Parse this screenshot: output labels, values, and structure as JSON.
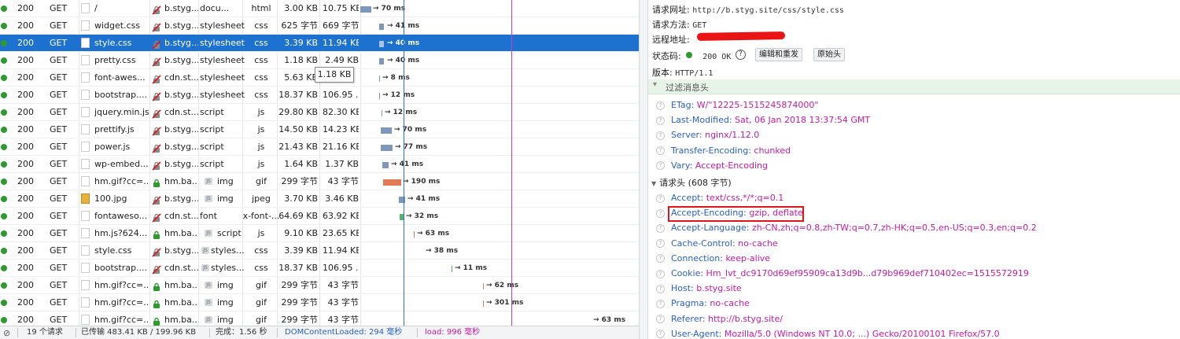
{
  "columns": [
    "status",
    "method",
    "file",
    "domain",
    "cause",
    "type",
    "transferred",
    "size",
    "waterfall"
  ],
  "requests": [
    {
      "status": "200",
      "method": "GET",
      "file": "/",
      "domain": "b.styg...",
      "cause": "docu...",
      "type": "html",
      "transferred": "3.00 KB",
      "size": "10.75 KB",
      "timing": "→ 70 ms",
      "icon": "doc",
      "lock": "broken",
      "selected": false
    },
    {
      "status": "200",
      "method": "GET",
      "file": "widget.css",
      "domain": "b.styg...",
      "cause": "stylesheet",
      "type": "css",
      "transferred": "625 字节",
      "size": "669 字节",
      "timing": "→ 41 ms",
      "icon": "doc",
      "lock": "broken",
      "selected": false
    },
    {
      "status": "200",
      "method": "GET",
      "file": "style.css",
      "domain": "b.styg...",
      "cause": "stylesheet",
      "type": "css",
      "transferred": "3.39 KB",
      "size": "11.94 KB",
      "timing": "→ 40 ms",
      "icon": "doc",
      "lock": "broken",
      "selected": true
    },
    {
      "status": "200",
      "method": "GET",
      "file": "pretty.css",
      "domain": "b.styg...",
      "cause": "stylesheet",
      "type": "css",
      "transferred": "1.18 KB",
      "size": "2.49 KB",
      "timing": "→ 40 ms",
      "icon": "doc",
      "lock": "broken",
      "selected": false
    },
    {
      "status": "200",
      "method": "GET",
      "file": "font-awes...",
      "domain": "cdn.st...",
      "cause": "stylesheet",
      "type": "css",
      "transferred": "5.63 KB",
      "size": "",
      "timing": "→ 8 ms",
      "icon": "doc",
      "lock": "broken",
      "selected": false
    },
    {
      "status": "200",
      "method": "GET",
      "file": "bootstrap....",
      "domain": "b.styg...",
      "cause": "stylesheet",
      "type": "css",
      "transferred": "18.37 KB",
      "size": "106.95 ...",
      "timing": "→ 12 ms",
      "icon": "doc",
      "lock": "broken",
      "selected": false
    },
    {
      "status": "200",
      "method": "GET",
      "file": "jquery.min.js",
      "domain": "cdn.st...",
      "cause": "script",
      "type": "js",
      "transferred": "29.80 KB",
      "size": "82.30 KB",
      "timing": "→ 12 ms",
      "icon": "doc",
      "lock": "broken",
      "selected": false
    },
    {
      "status": "200",
      "method": "GET",
      "file": "prettify.js",
      "domain": "b.styg...",
      "cause": "script",
      "type": "js",
      "transferred": "14.50 KB",
      "size": "14.23 KB",
      "timing": "→ 70 ms",
      "icon": "doc",
      "lock": "broken",
      "selected": false
    },
    {
      "status": "200",
      "method": "GET",
      "file": "power.js",
      "domain": "b.styg...",
      "cause": "script",
      "type": "js",
      "transferred": "21.43 KB",
      "size": "21.16 KB",
      "timing": "→ 77 ms",
      "icon": "doc",
      "lock": "broken",
      "selected": false
    },
    {
      "status": "200",
      "method": "GET",
      "file": "wp-embed...",
      "domain": "b.styg...",
      "cause": "script",
      "type": "js",
      "transferred": "1.64 KB",
      "size": "1.37 KB",
      "timing": "→ 41 ms",
      "icon": "doc",
      "lock": "broken",
      "selected": false
    },
    {
      "status": "200",
      "method": "GET",
      "file": "hm.gif?cc=...",
      "domain": "hm.ba...",
      "cause": "img",
      "type": "gif",
      "transferred": "299 字节",
      "size": "43 字节",
      "timing": "→ 190 ms",
      "icon": "doc",
      "lock": "secure",
      "selected": false
    },
    {
      "status": "200",
      "method": "GET",
      "file": "100.jpg",
      "domain": "b.styg...",
      "cause": "img",
      "type": "jpeg",
      "transferred": "3.70 KB",
      "size": "3.46 KB",
      "timing": "→ 41 ms",
      "icon": "img",
      "lock": "broken",
      "selected": false
    },
    {
      "status": "200",
      "method": "GET",
      "file": "fontaweso...",
      "domain": "cdn.st...",
      "cause": "font",
      "type": "x-font-...",
      "transferred": "64.69 KB",
      "size": "63.92 KB",
      "timing": "→ 32 ms",
      "icon": "doc",
      "lock": "broken",
      "selected": false
    },
    {
      "status": "200",
      "method": "GET",
      "file": "hm.js?624...",
      "domain": "hm.ba...",
      "cause": "script",
      "type": "js",
      "transferred": "9.10 KB",
      "size": "23.65 KB",
      "timing": "→ 63 ms",
      "icon": "doc",
      "lock": "secure",
      "selected": false
    },
    {
      "status": "200",
      "method": "GET",
      "file": "style.css",
      "domain": "b.styg...",
      "cause": "styles...",
      "type": "css",
      "transferred": "3.39 KB",
      "size": "11.94 KB",
      "timing": "→ 38 ms",
      "icon": "doc",
      "lock": "broken",
      "selected": false
    },
    {
      "status": "200",
      "method": "GET",
      "file": "bootstrap....",
      "domain": "cdn.st...",
      "cause": "styles...",
      "type": "css",
      "transferred": "18.37 KB",
      "size": "106.95 ...",
      "timing": "→ 11 ms",
      "icon": "doc",
      "lock": "broken",
      "selected": false
    },
    {
      "status": "200",
      "method": "GET",
      "file": "hm.gif?cc=...",
      "domain": "hm.ba...",
      "cause": "img",
      "type": "gif",
      "transferred": "299 字节",
      "size": "43 字节",
      "timing": "→ 62 ms",
      "icon": "doc",
      "lock": "secure",
      "selected": false
    },
    {
      "status": "200",
      "method": "GET",
      "file": "hm.gif?cc=...",
      "domain": "hm.ba...",
      "cause": "img",
      "type": "gif",
      "transferred": "299 字节",
      "size": "43 字节",
      "timing": "→ 301 ms",
      "icon": "doc",
      "lock": "secure",
      "selected": false
    },
    {
      "status": "200",
      "method": "GET",
      "file": "hm.gif?cc=...",
      "domain": "hm.ba...",
      "cause": "img",
      "type": "gif",
      "transferred": "299 字节",
      "size": "43 字节",
      "timing": "→ 63 ms",
      "icon": "doc",
      "lock": "secure",
      "selected": false
    }
  ],
  "tooltip": "1.18 KB",
  "statusbar": {
    "requests": "19 个请求",
    "transferred": "已传输 483.41 KB / 199.96 KB",
    "finish": "完成：1.56 秒",
    "dom_loaded": "DOMContentLoaded: 294 毫秒",
    "load": "load: 996 毫秒"
  },
  "details": {
    "url_label": "请求网址:",
    "url_value": "http://b.styg.site/css/style.css",
    "method_label": "请求方法:",
    "method_value": "GET",
    "remote_label": "远程地址:",
    "status_label": "状态码:",
    "status_value": "200 OK",
    "help_glyph": "?",
    "edit_resend_button": "编辑和重发",
    "raw_headers_button": "原始头",
    "version_label": "版本:",
    "version_value": "HTTP/1.1",
    "filter_placeholder": "过滤消息头",
    "request_headers_title": "请求头 (608 字节)"
  },
  "response_headers": [
    {
      "name": "ETag:",
      "value": "W/\"12225-1515245874000\""
    },
    {
      "name": "Last-Modified:",
      "value": "Sat, 06 Jan 2018 13:37:54 GMT"
    },
    {
      "name": "Server:",
      "value": "nginx/1.12.0"
    },
    {
      "name": "Transfer-Encoding:",
      "value": "chunked"
    },
    {
      "name": "Vary:",
      "value": "Accept-Encoding"
    }
  ],
  "request_headers": [
    {
      "name": "Accept:",
      "value": "text/css,*/*;q=0.1"
    },
    {
      "name": "Accept-Encoding:",
      "value": "gzip, deflate"
    },
    {
      "name": "Accept-Language:",
      "value": "zh-CN,zh;q=0.8,zh-TW;q=0.7,zh-HK;q=0.5,en-US;q=0.3,en;q=0.2"
    },
    {
      "name": "Cache-Control:",
      "value": "no-cache"
    },
    {
      "name": "Connection:",
      "value": "keep-alive"
    },
    {
      "name": "Cookie:",
      "value": "Hm_lvt_dc9170d69ef95909ca13d9b...d79b969def710402ec=1515572919"
    },
    {
      "name": "Host:",
      "value": "b.styg.site"
    },
    {
      "name": "Pragma:",
      "value": "no-cache"
    },
    {
      "name": "Referer:",
      "value": "http://b.styg.site/"
    },
    {
      "name": "User-Agent:",
      "value": "Mozilla/5.0 (Windows NT 10.0; ...) Gecko/20100101 Firefox/57.0"
    }
  ],
  "colors": {
    "selected_row": "#1e72cf",
    "status_ok": "#2c9b2c",
    "header_name": "#2a60c6",
    "header_value": "#c41ba4",
    "highlight_box": "#e0141b",
    "dom_loaded_line": "#2a72d0",
    "load_line": "#c43cc8"
  }
}
